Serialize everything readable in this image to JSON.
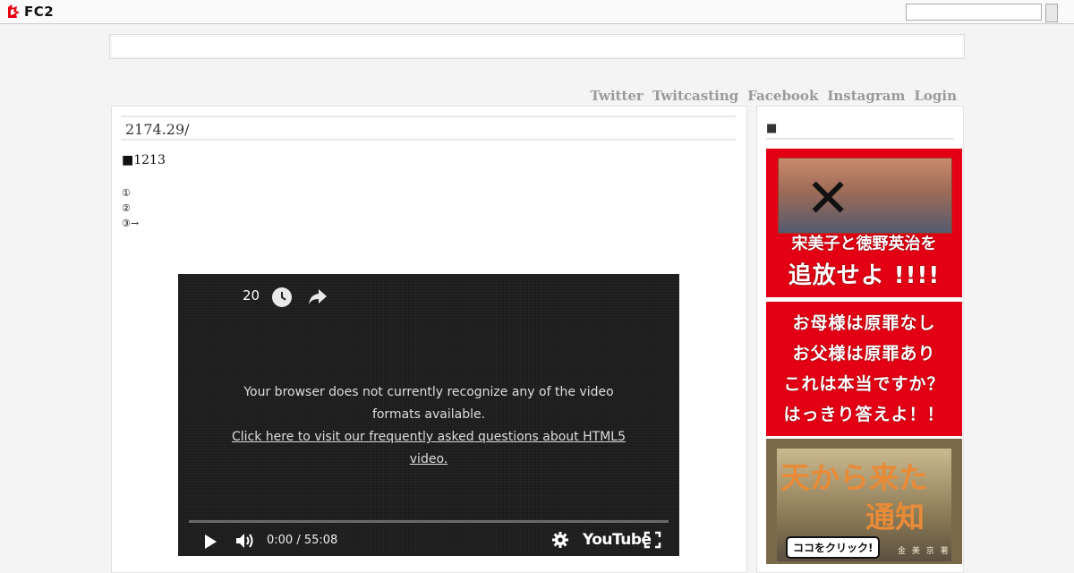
{
  "fc2bar": {
    "logo_text": "FC2",
    "search_placeholder": ""
  },
  "nav": [
    "Twitter",
    "Twitcasting",
    "Facebook",
    "Instagram",
    "Login"
  ],
  "entry": {
    "title": "2174.29/",
    "line1": "■1213",
    "list": [
      "①",
      "②",
      "③→"
    ],
    "circle_label": "①"
  },
  "video": {
    "title": "20",
    "message": "Your browser does not currently recognize any of the video formats available.",
    "link": "Click here to visit our frequently asked questions about HTML5 video.",
    "time": "0:00 / 55:08",
    "brand": "YouTube"
  },
  "sidebar": {
    "title": "■",
    "banner1": {
      "names": "宋美子と徳野英治を",
      "slogan": "追放せよ !!!!"
    },
    "banner2": {
      "lines": [
        "お母様は原罪なし",
        "お父様は原罪あり",
        "これは本当ですか？",
        "はっきり答えよ！！"
      ]
    },
    "banner3": {
      "title1": "天から来た",
      "title2": "通知",
      "button": "ココをクリック!",
      "author": "金 美 京 著"
    }
  },
  "colors": {
    "banner_red": "#e40014",
    "nav_gray": "#9a9a9a",
    "video_bg": "#1c1c1c"
  },
  "icons": [
    "fc2-logo-icon",
    "clock-icon",
    "share-icon",
    "play-icon",
    "volume-icon",
    "settings-gear-icon",
    "fullscreen-icon"
  ]
}
